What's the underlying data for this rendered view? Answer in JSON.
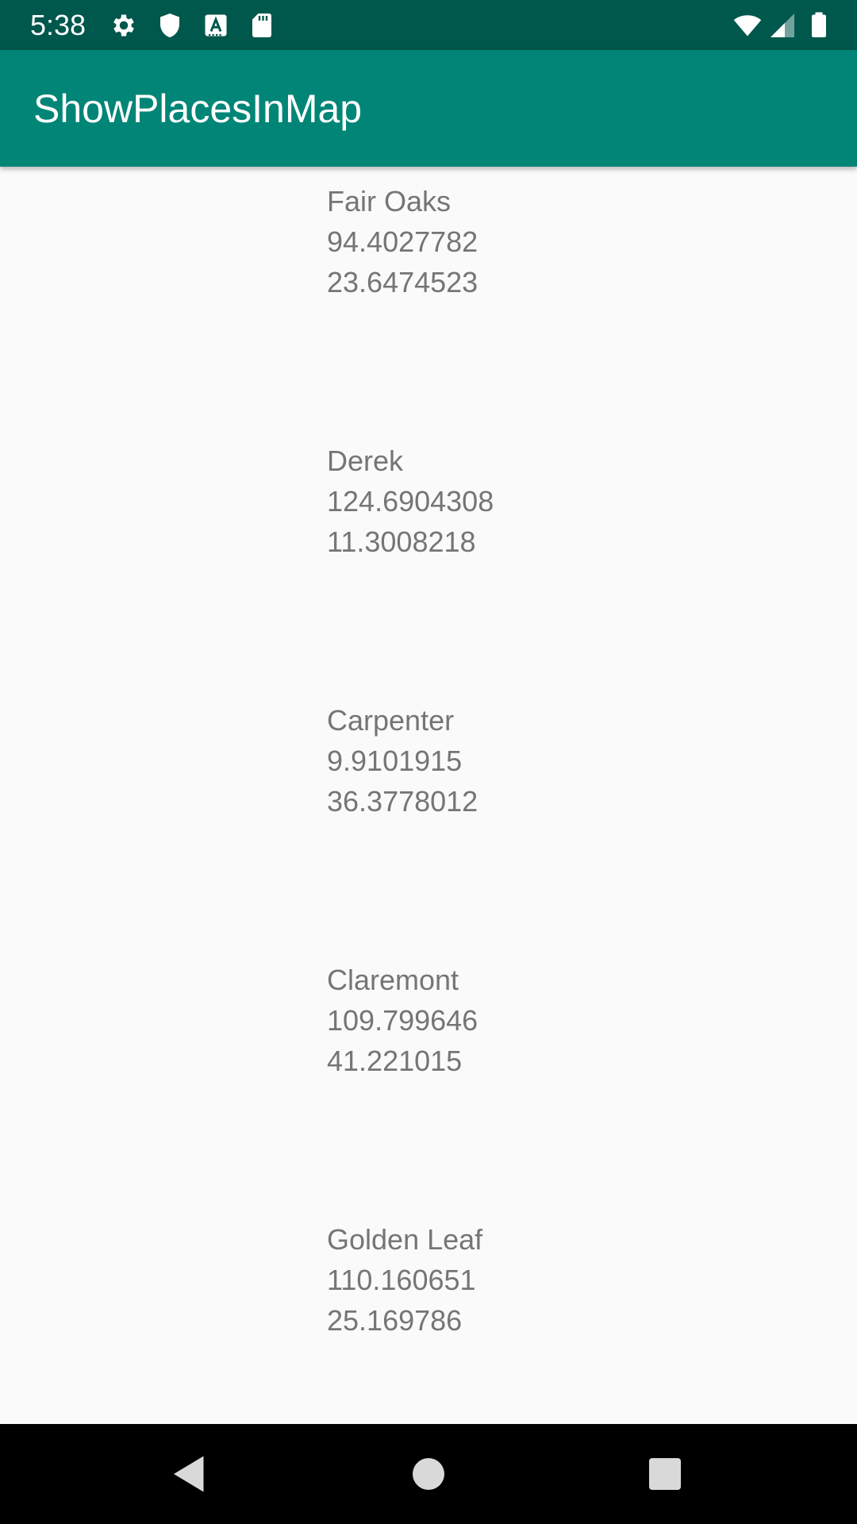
{
  "status_bar": {
    "time": "5:38",
    "icons": [
      "gear-icon",
      "shield-icon",
      "a-icon",
      "sd-card-icon",
      "wifi-icon",
      "signal-icon",
      "battery-icon"
    ]
  },
  "app_bar": {
    "title": "ShowPlacesInMap"
  },
  "places": [
    {
      "name": "Fair Oaks",
      "longitude": "94.4027782",
      "latitude": "23.6474523"
    },
    {
      "name": "Derek",
      "longitude": "124.6904308",
      "latitude": "11.3008218"
    },
    {
      "name": "Carpenter",
      "longitude": "9.9101915",
      "latitude": "36.3778012"
    },
    {
      "name": "Claremont",
      "longitude": "109.799646",
      "latitude": "41.221015"
    },
    {
      "name": "Golden Leaf",
      "longitude": "110.160651",
      "latitude": "25.169786"
    }
  ],
  "nav_bar": {
    "buttons": [
      "back-icon",
      "home-icon",
      "recents-icon"
    ]
  },
  "colors": {
    "status_bar": "#00574b",
    "app_bar": "#008577",
    "text_secondary": "#757575",
    "background": "#fafafa"
  }
}
